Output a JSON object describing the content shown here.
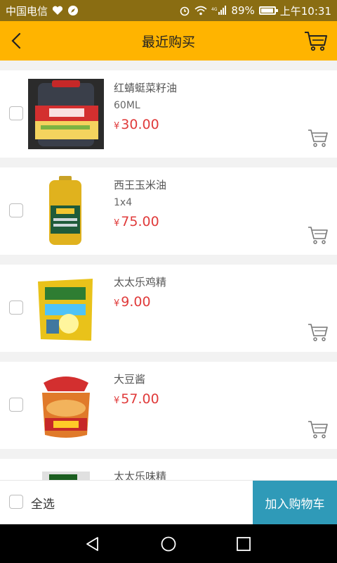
{
  "status_bar": {
    "carrier": "中国电信",
    "battery": "89%",
    "time": "上午10:31",
    "network": "4G"
  },
  "header": {
    "title": "最近购买",
    "back_icon": "chevron-left-icon",
    "cart_icon": "cart-icon"
  },
  "products": [
    {
      "name": "红蜻蜓菜籽油",
      "spec": "60ML",
      "currency": "¥",
      "price": "30.00",
      "image": "oil-bottle-image"
    },
    {
      "name": "西王玉米油",
      "spec": "1x4",
      "currency": "¥",
      "price": "75.00",
      "image": "corn-oil-image"
    },
    {
      "name": "太太乐鸡精",
      "spec": "",
      "currency": "¥",
      "price": "9.00",
      "image": "chicken-essence-bag-image"
    },
    {
      "name": "大豆酱",
      "spec": "",
      "currency": "¥",
      "price": "57.00",
      "image": "soybean-paste-jar-image"
    },
    {
      "name": "太太乐味精",
      "spec": "",
      "currency": "¥",
      "price": "",
      "image": "msg-package-image"
    }
  ],
  "bottom_bar": {
    "select_all_label": "全选",
    "add_to_cart_label": "加入购物车"
  },
  "colors": {
    "header": "#ffb400",
    "status_bar": "#8a6d12",
    "price": "#e03b3b",
    "add_to_cart": "#2f9ab8"
  }
}
